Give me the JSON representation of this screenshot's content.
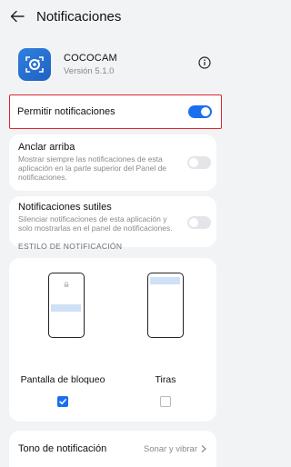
{
  "header": {
    "title": "Notificaciones",
    "back_icon": "arrow-left-icon"
  },
  "app": {
    "name": "COCOCAM",
    "version": "Versión 5.1.0",
    "icon": "camera-app-icon",
    "info_icon": "info-icon"
  },
  "settings": {
    "allow": {
      "label": "Permitir notificaciones",
      "enabled": true
    },
    "pin_top": {
      "label": "Anclar arriba",
      "desc": "Mostrar siempre las notificaciones de esta aplicación en la parte superior del Panel de notificaciones.",
      "enabled": false
    },
    "subtle": {
      "label": "Notificaciones sutiles",
      "desc": "Silenciar notificaciones de esta aplicación y solo mostrarlas en el panel de notificaciones.",
      "enabled": false
    }
  },
  "style_section": {
    "heading": "ESTILO DE NOTIFICACIÓN",
    "options": [
      {
        "label": "Pantalla de bloqueo",
        "checked": true
      },
      {
        "label": "Tiras",
        "checked": false
      }
    ]
  },
  "tone": {
    "label": "Tono de notificación",
    "value": "Sonar y vibrar"
  },
  "colors": {
    "accent": "#1a6ff0",
    "highlight_border": "#e0262f",
    "background": "#f1f3f5"
  }
}
